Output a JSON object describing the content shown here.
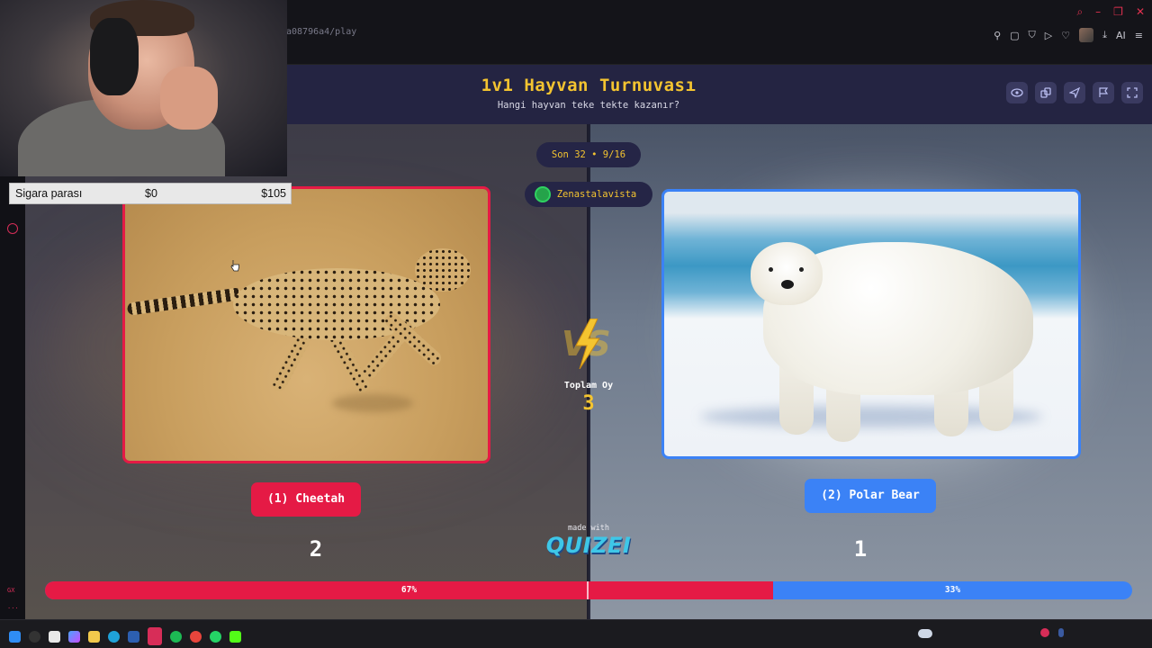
{
  "browser": {
    "url_fragment": "a08796a4/play",
    "ai_label": "AI"
  },
  "overlay_widget": {
    "label": "Sigara parası",
    "min_value": "$0",
    "max_value": "$105"
  },
  "header": {
    "title": "1v1 Hayvan Turnuvası",
    "subtitle": "Hangi hayvan teke tekte kazanır?",
    "actions": [
      "eye-icon",
      "share-icon",
      "send-icon",
      "flag-icon",
      "fullscreen-icon"
    ]
  },
  "round": {
    "label": "Son 32 • 9/16"
  },
  "user": {
    "name": "Zenastalavista"
  },
  "left": {
    "button": "(1) Cheetah",
    "votes": "2",
    "percent": "67%",
    "fraction": 0.67,
    "color": "#e51a45"
  },
  "right": {
    "button": "(2) Polar Bear",
    "votes": "1",
    "percent": "33%",
    "fraction": 0.33,
    "color": "#3b82f6"
  },
  "center": {
    "total_label": "Toplam Oy",
    "total_value": "3",
    "made_with": "made with",
    "logo": "QUIZEI"
  },
  "left_rail": {
    "bottom_text_1": "GX",
    "bottom_text_2": "..."
  }
}
